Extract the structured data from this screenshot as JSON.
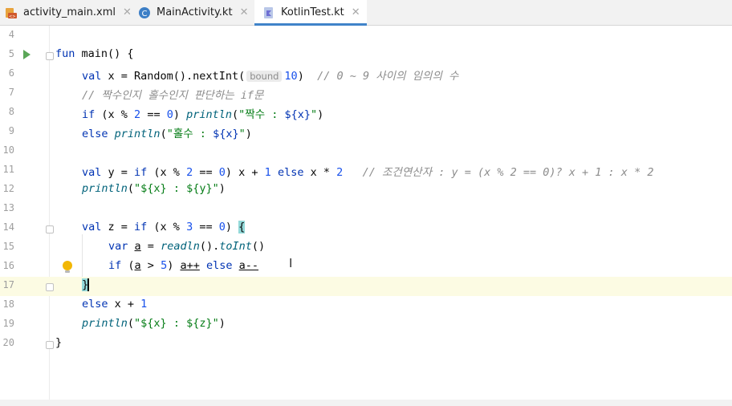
{
  "tabs": [
    {
      "label": "activity_main.xml",
      "icon": "xml-file-icon",
      "active": false
    },
    {
      "label": "MainActivity.kt",
      "icon": "kotlin-class-icon",
      "active": false
    },
    {
      "label": "KotlinTest.kt",
      "icon": "kotlin-file-icon",
      "active": true
    }
  ],
  "editor": {
    "line_numbers": [
      "4",
      "5",
      "6",
      "7",
      "8",
      "9",
      "10",
      "11",
      "12",
      "13",
      "14",
      "15",
      "16",
      "17",
      "18",
      "19",
      "20"
    ],
    "current_line": "17",
    "parameter_hint": "bound",
    "line5": {
      "kw": "fun",
      "rest": " main() {"
    },
    "line6": {
      "kw": "val",
      "a": " x = Random().nextInt(",
      "num": "10",
      "b": ")",
      "comment": "// 0 ~ 9 사이의 임의의 수"
    },
    "line7": {
      "comment": "// 짝수인지 홀수인지 판단하는 if문"
    },
    "line8": {
      "kw": "if",
      "a": " (x % ",
      "n1": "2",
      "b": " == ",
      "n2": "0",
      "c": ") ",
      "fn": "println",
      "d": "(",
      "s1": "\"짝수 : ",
      "tmpl": "${x}",
      "s2": "\"",
      "e": ")"
    },
    "line9": {
      "kw": "else",
      "fn": "println",
      "d": "(",
      "s1": "\"홀수 : ",
      "tmpl": "${x}",
      "s2": "\"",
      "e": ")"
    },
    "line11": {
      "kw1": "val",
      "a": " y = ",
      "kw2": "if",
      "b": " (x % ",
      "n1": "2",
      "c": " == ",
      "n2": "0",
      "d": ") x + ",
      "n3": "1",
      "kw3": "else",
      "e": " x * ",
      "n4": "2",
      "comment": "// 조건연산자 : y = (x % 2 == 0)? x + 1 : x * 2"
    },
    "line12": {
      "fn": "println",
      "a": "(",
      "s": "\"${x} : ${y}\"",
      "b": ")"
    },
    "line14": {
      "kw1": "val",
      "a": " z = ",
      "kw2": "if",
      "b": " (x % ",
      "n1": "3",
      "c": " == ",
      "n2": "0",
      "d": ") ",
      "brace": "{"
    },
    "line15": {
      "kw": "var",
      "var": "a",
      "a": " = ",
      "fn1": "readln",
      "b": "().",
      "fn2": "toInt",
      "c": "()"
    },
    "line16": {
      "kw1": "if",
      "a": " (",
      "var1": "a",
      "b": " > ",
      "n1": "5",
      "c": ") ",
      "var2": "a++",
      "kw2": "else",
      "var3": "a--"
    },
    "line17": {
      "brace": "}"
    },
    "line18": {
      "kw": "else",
      "rest": " x + ",
      "num": "1"
    },
    "line19": {
      "fn": "println",
      "a": "(",
      "s": "\"${x} : ${z}\"",
      "b": ")"
    },
    "line20": {
      "rest": "}"
    }
  }
}
